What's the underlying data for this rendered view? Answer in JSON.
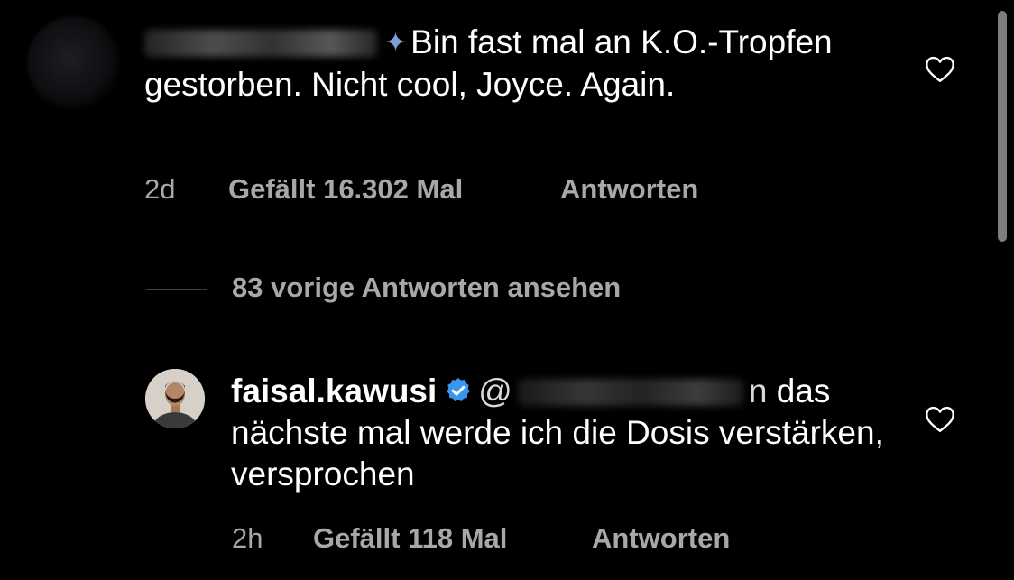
{
  "comment": {
    "star_icon": "✦",
    "text": "Bin fast mal an K.O.-Tropfen gestorben. Nicht cool, Joyce. Again.",
    "time": "2d",
    "likes": "Gefällt 16.302 Mal",
    "reply_label": "Antworten"
  },
  "view_replies": {
    "label": "83 vorige Antworten ansehen"
  },
  "reply": {
    "username": "faisal.kawusi",
    "mention_prefix": "@",
    "mention_suffix": "n",
    "text": "das nächste mal werde ich die Dosis verstärken, versprochen",
    "time": "2h",
    "likes": "Gefällt 118 Mal",
    "reply_label": "Antworten"
  },
  "colors": {
    "background": "#000000",
    "text": "#ffffff",
    "secondary_text": "#a8a8a8",
    "verified_badge": "#3897f0"
  },
  "icons": {
    "like": "heart-outline-icon",
    "verified": "verified-badge-icon"
  }
}
